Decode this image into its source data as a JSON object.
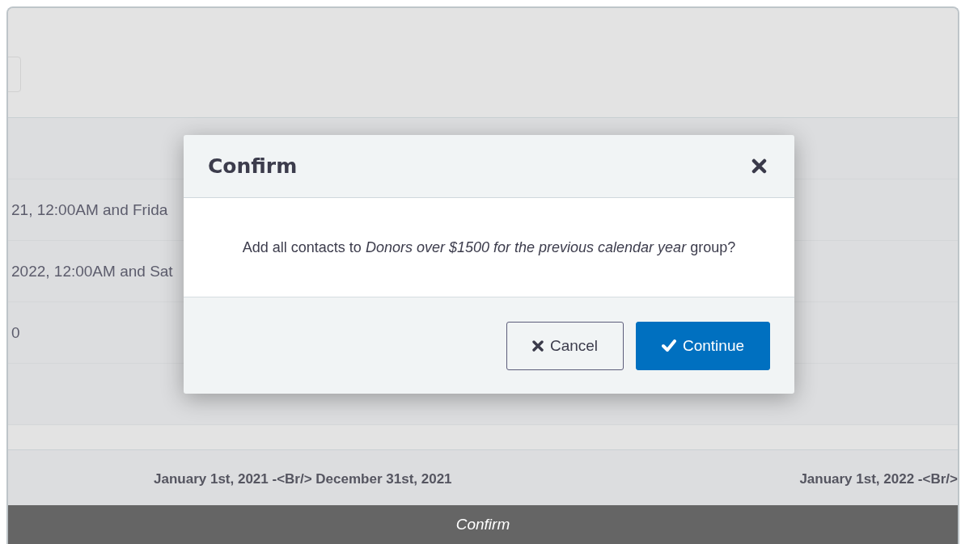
{
  "table": {
    "rows": [
      {
        "text": "21, 12:00AM and Frida"
      },
      {
        "text": "2022, 12:00AM and Sat"
      },
      {
        "text": "0"
      }
    ]
  },
  "footer": {
    "cells": [
      "January 1st, 2021 -<Br/> December 31st, 2021",
      "January 1st, 2022 -<Br/>"
    ]
  },
  "dialog": {
    "title": "Confirm",
    "message": "Add all contacts to *Donors over $1500 for the previous calendar year* group?",
    "buttons": [
      {
        "label": "Cancel",
        "kind": "secondary"
      },
      {
        "label": "Continue",
        "kind": "primary"
      }
    ]
  },
  "status_bar": {
    "label": "Confirm"
  }
}
